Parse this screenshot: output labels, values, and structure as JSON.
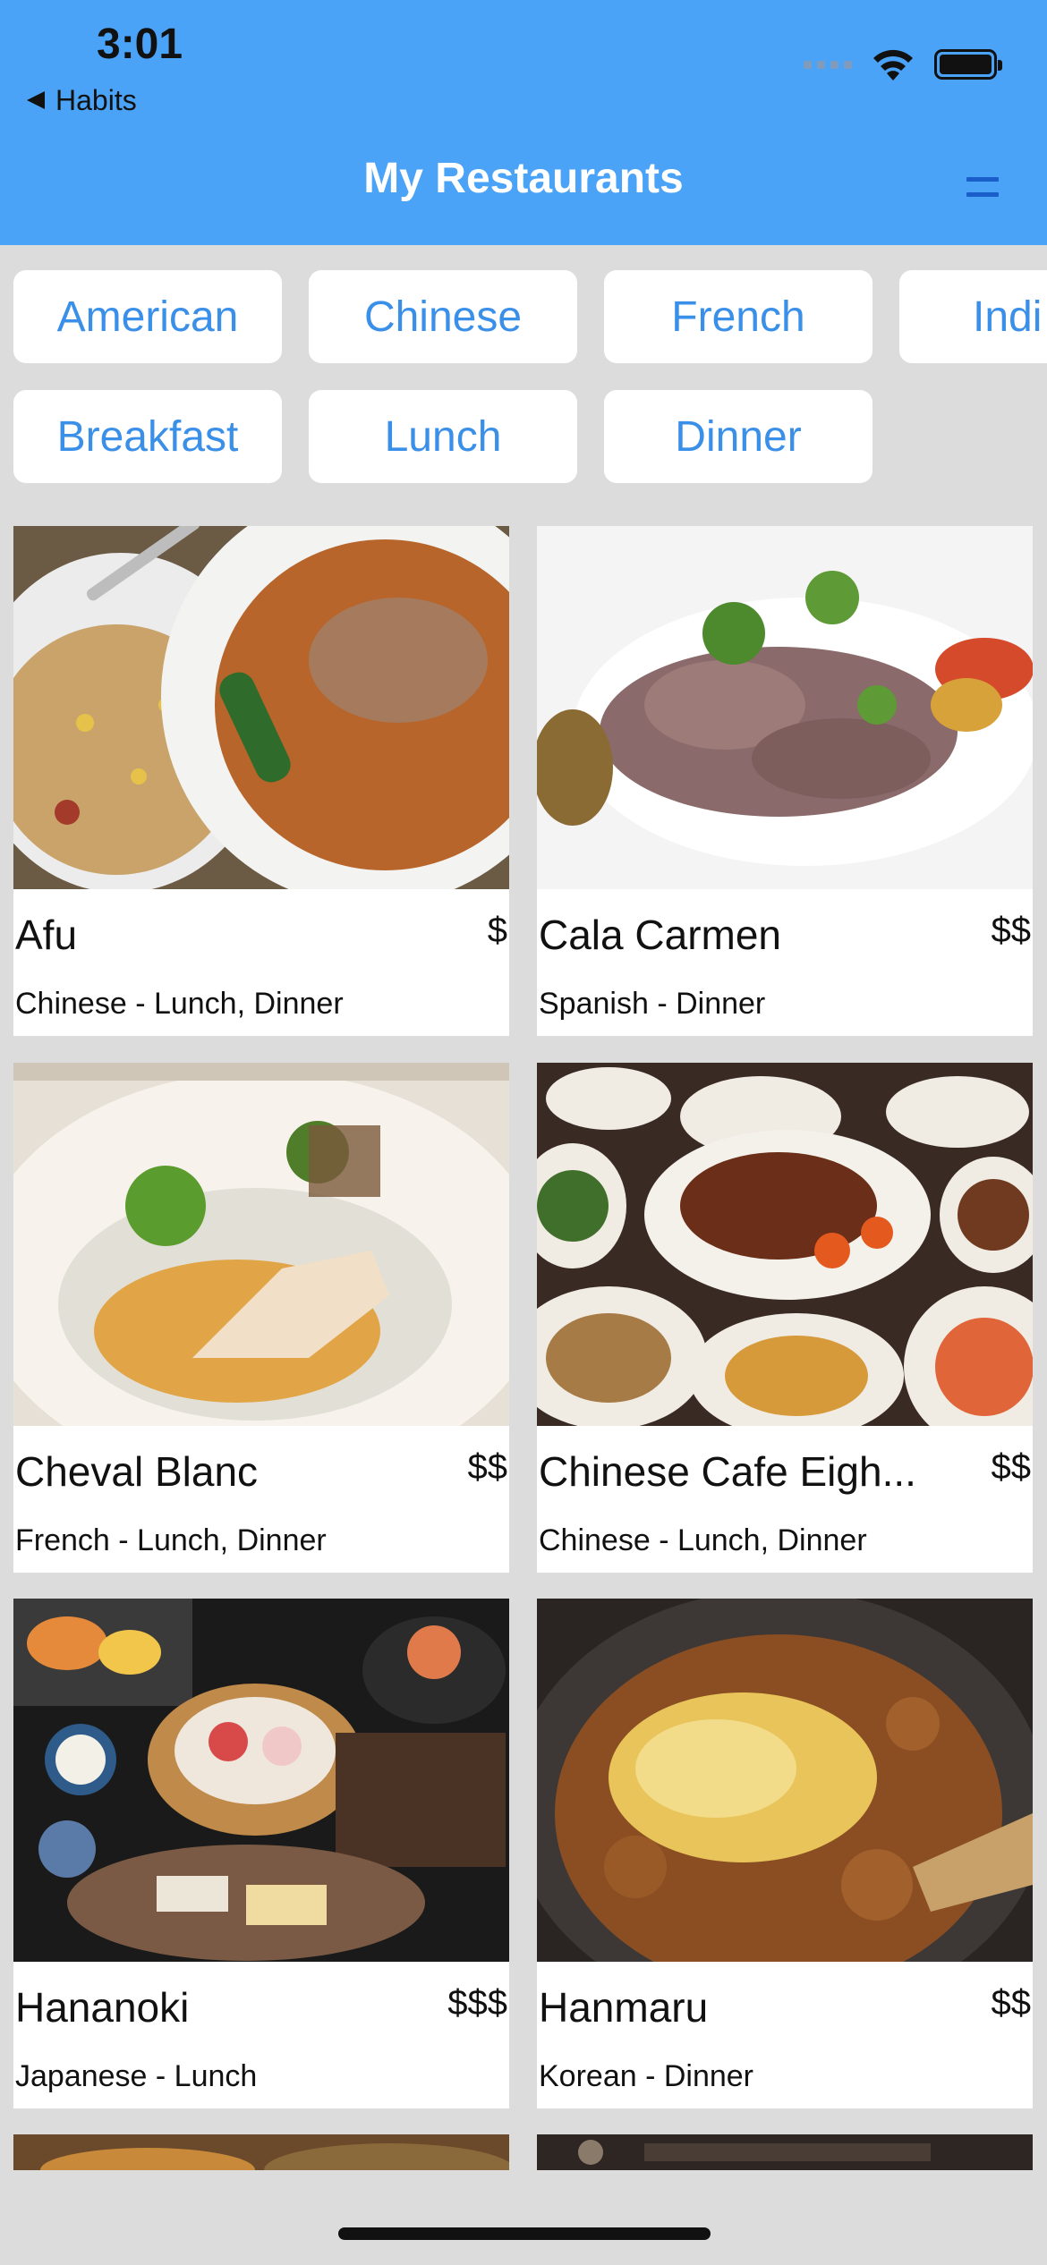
{
  "status_bar": {
    "time": "3:01",
    "back_label": "Habits"
  },
  "nav": {
    "title": "My Restaurants",
    "menu_icon": "menu-icon"
  },
  "filters": {
    "cuisines": [
      "American",
      "Chinese",
      "French",
      "Indi"
    ],
    "meals": [
      "Breakfast",
      "Lunch",
      "Dinner"
    ]
  },
  "restaurants": [
    {
      "name": "Afu",
      "price": "$",
      "desc": "Chinese - Lunch, Dinner"
    },
    {
      "name": "Cala Carmen",
      "price": "$$",
      "desc": "Spanish - Dinner"
    },
    {
      "name": "Cheval Blanc",
      "price": "$$",
      "desc": "French - Lunch, Dinner"
    },
    {
      "name": "Chinese Cafe Eigh...",
      "price": "$$",
      "desc": "Chinese - Lunch, Dinner"
    },
    {
      "name": "Hananoki",
      "price": "$$$",
      "desc": "Japanese - Lunch"
    },
    {
      "name": "Hanmaru",
      "price": "$$",
      "desc": "Korean - Dinner"
    }
  ],
  "colors": {
    "header": "#4aa3f7",
    "accent": "#3a8fe8",
    "background": "#dcdcdc"
  }
}
